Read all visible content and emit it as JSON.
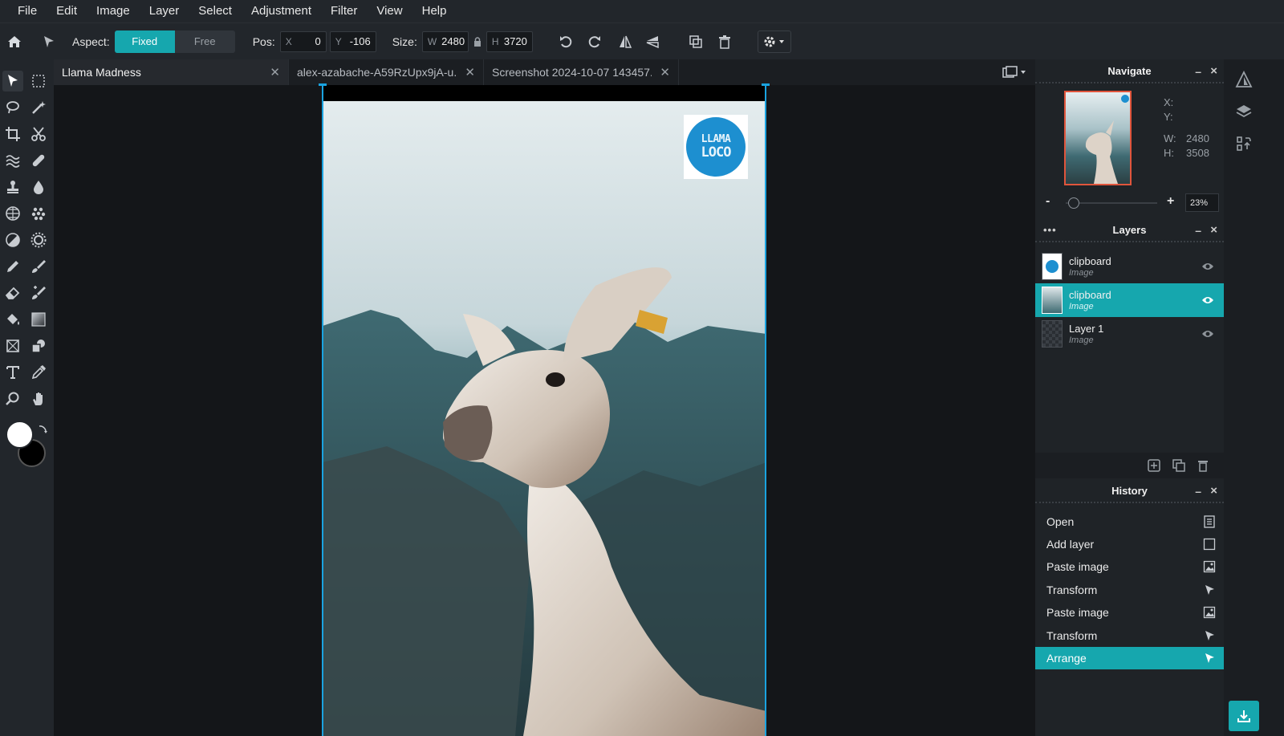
{
  "menu": [
    "File",
    "Edit",
    "Image",
    "Layer",
    "Select",
    "Adjustment",
    "Filter",
    "View",
    "Help"
  ],
  "toolbar": {
    "aspect_label": "Aspect:",
    "aspect_fixed": "Fixed",
    "aspect_free": "Free",
    "pos_label": "Pos:",
    "x_key": "X",
    "x_value": "0",
    "y_key": "Y",
    "y_value": "-106",
    "size_label": "Size:",
    "w_key": "W",
    "w_value": "2480",
    "h_key": "H",
    "h_value": "3720"
  },
  "tabs": [
    {
      "label": "Llama Madness"
    },
    {
      "label": "alex-azabache-A59RzUpx9jA-u..."
    },
    {
      "label": "Screenshot 2024-10-07 143457..."
    }
  ],
  "canvas": {
    "logo_line1": "LLAMA",
    "logo_line2": "LOCO"
  },
  "navigate": {
    "title": "Navigate",
    "x_label": "X:",
    "y_label": "Y:",
    "w_label": "W:",
    "w_value": "2480",
    "h_label": "H:",
    "h_value": "3508",
    "zoom_minus": "-",
    "zoom_plus": "+",
    "zoom_value": "23%",
    "zoom_level": 0.03
  },
  "layers": {
    "title": "Layers",
    "dots": "•••",
    "items": [
      {
        "name": "clipboard",
        "type": "Image",
        "selected": false
      },
      {
        "name": "clipboard",
        "type": "Image",
        "selected": true
      },
      {
        "name": "Layer 1",
        "type": "Image",
        "selected": false
      }
    ]
  },
  "history": {
    "title": "History",
    "items": [
      {
        "label": "Open",
        "icon": "document-icon"
      },
      {
        "label": "Add layer",
        "icon": "square-icon"
      },
      {
        "label": "Paste image",
        "icon": "image-icon"
      },
      {
        "label": "Transform",
        "icon": "arrow-icon"
      },
      {
        "label": "Paste image",
        "icon": "image-icon"
      },
      {
        "label": "Transform",
        "icon": "arrow-icon"
      },
      {
        "label": "Arrange",
        "icon": "arrow-icon",
        "selected": true
      }
    ]
  },
  "colors": {
    "accent": "#16a7ae",
    "foreground": "#ffffff",
    "background": "#000000"
  },
  "panel_controls": {
    "minimize": "–",
    "close": "×"
  }
}
